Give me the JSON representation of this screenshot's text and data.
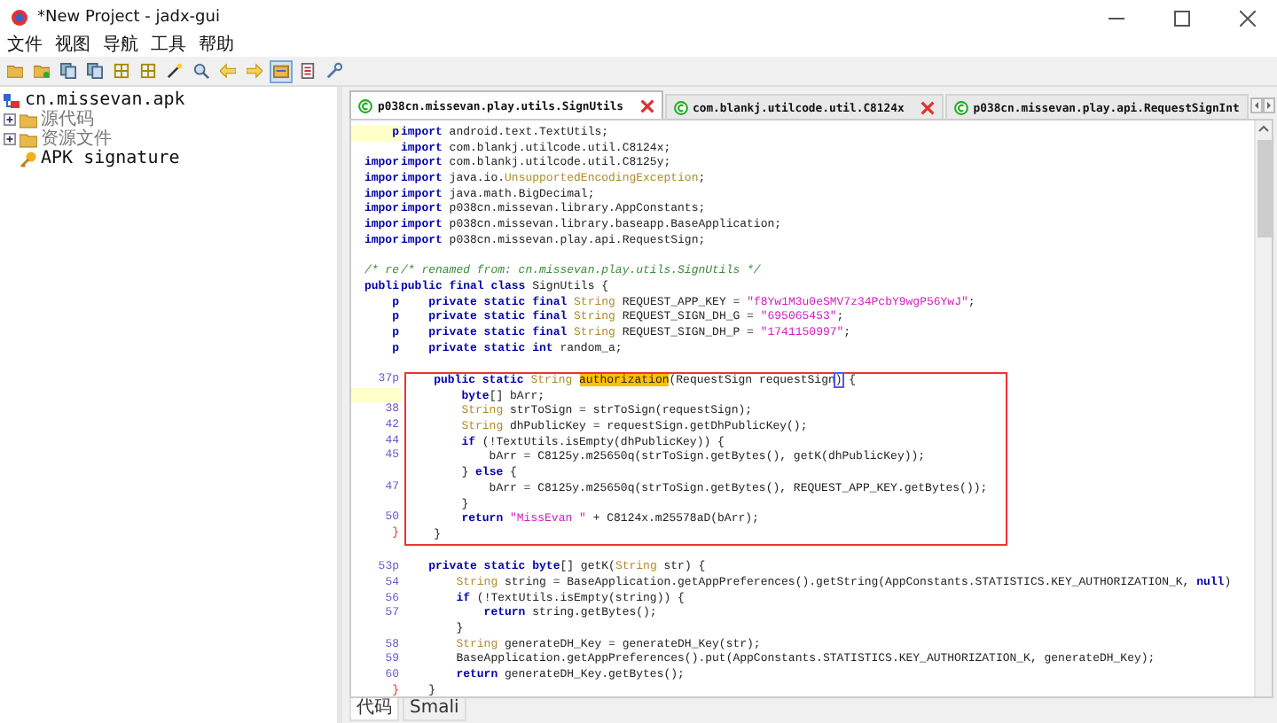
{
  "window": {
    "title": "*New Project - jadx-gui"
  },
  "menu": [
    "文件",
    "视图",
    "导航",
    "工具",
    "帮助"
  ],
  "toolbar": {
    "buttons": [
      {
        "kind": "open",
        "selected": false
      },
      {
        "kind": "add",
        "selected": false
      },
      {
        "kind": "copy",
        "selected": false
      },
      {
        "kind": "copy",
        "selected": false
      },
      {
        "kind": "tree",
        "selected": false
      },
      {
        "kind": "grid",
        "selected": false
      },
      {
        "kind": "wand",
        "selected": false
      },
      {
        "kind": "search",
        "selected": false
      },
      {
        "kind": "back",
        "selected": false
      },
      {
        "kind": "forward",
        "selected": false
      },
      {
        "kind": "sync",
        "selected": true
      },
      {
        "kind": "log",
        "selected": false
      },
      {
        "kind": "wrench",
        "selected": false
      }
    ]
  },
  "tree": {
    "root": {
      "label": "cn.missevan.apk",
      "children": [
        {
          "label": "源代码",
          "kind": "folder",
          "expanded": false
        },
        {
          "label": "资源文件",
          "kind": "folder",
          "expanded": false
        },
        {
          "label": "APK signature",
          "kind": "key"
        }
      ]
    }
  },
  "editor_tabs": [
    {
      "label": "p038cn.missevan.play.utils.SignUtils",
      "selected": true,
      "closable": true
    },
    {
      "label": "com.blankj.utilcode.util.C8124x",
      "selected": false,
      "closable": true
    },
    {
      "label": "p038cn.missevan.play.api.RequestSignInt",
      "selected": false,
      "closable": false
    }
  ],
  "code": {
    "blocks": [
      {
        "kind": "plain",
        "lines": [
          {
            "gutter": {
              "kind": "mark",
              "text": "p"
            },
            "highlighted": true,
            "tokens": [
              {
                "kind": "kw",
                "text": "import"
              },
              {
                "kind": "plain",
                "text": " android.text.TextUtils;"
              }
            ]
          },
          {
            "highlighted": false,
            "tokens": [
              {
                "kind": "kw",
                "text": "import"
              },
              {
                "kind": "plain",
                "text": " com.blankj.utilcode.util.C8124x;"
              }
            ]
          },
          {
            "gutter": {
              "kind": "mark",
              "text": "impor"
            },
            "highlighted": false,
            "tokens": [
              {
                "kind": "kw",
                "text": "import"
              },
              {
                "kind": "plain",
                "text": " com.blankj.utilcode.util.C8125y;"
              }
            ]
          },
          {
            "gutter": {
              "kind": "mark",
              "text": "impor"
            },
            "highlighted": false,
            "tokens": [
              {
                "kind": "kw",
                "text": "import"
              },
              {
                "kind": "plain",
                "text": " java.io."
              },
              {
                "kind": "type",
                "text": "UnsupportedEncodingException"
              },
              {
                "kind": "plain",
                "text": ";"
              }
            ]
          },
          {
            "gutter": {
              "kind": "mark",
              "text": "impor"
            },
            "highlighted": false,
            "tokens": [
              {
                "kind": "kw",
                "text": "import"
              },
              {
                "kind": "plain",
                "text": " java.math.BigDecimal;"
              }
            ]
          },
          {
            "gutter": {
              "kind": "mark",
              "text": "impor"
            },
            "highlighted": false,
            "tokens": [
              {
                "kind": "kw",
                "text": "import"
              },
              {
                "kind": "plain",
                "text": " p038cn.missevan.library.AppConstants;"
              }
            ]
          },
          {
            "gutter": {
              "kind": "mark",
              "text": "impor"
            },
            "highlighted": false,
            "tokens": [
              {
                "kind": "kw",
                "text": "import"
              },
              {
                "kind": "plain",
                "text": " p038cn.missevan.library.baseapp.BaseApplication;"
              }
            ]
          },
          {
            "gutter": {
              "kind": "mark",
              "text": "impor"
            },
            "highlighted": false,
            "tokens": [
              {
                "kind": "kw",
                "text": "import"
              },
              {
                "kind": "plain",
                "text": " p038cn.missevan.play.api.RequestSign;"
              }
            ]
          },
          {
            "highlighted": false
          },
          {
            "gutter": {
              "kind": "com",
              "text": "/* re"
            },
            "highlighted": false,
            "tokens": [
              {
                "kind": "com",
                "text": "/* renamed from: cn.missevan.play.utils.SignUtils */"
              }
            ]
          },
          {
            "gutter": {
              "kind": "mark",
              "text": "publi"
            },
            "highlighted": false,
            "tokens": [
              {
                "kind": "kw",
                "text": "public final class"
              },
              {
                "kind": "plain",
                "text": " SignUtils {"
              }
            ]
          },
          {
            "gutter": {
              "kind": "mark",
              "text": "p"
            },
            "highlighted": false,
            "tokens": [
              {
                "kind": "kw",
                "text": "    private static final"
              },
              {
                "kind": "type",
                "text": " String"
              },
              {
                "kind": "plain",
                "text": " REQUEST_APP_KEY = "
              },
              {
                "kind": "str",
                "text": "\"f8Yw1M3u0eSMV7z34PcbY9wgP56YwJ\""
              },
              {
                "kind": "plain",
                "text": ";"
              }
            ]
          },
          {
            "gutter": {
              "kind": "mark",
              "text": "p"
            },
            "highlighted": false,
            "tokens": [
              {
                "kind": "kw",
                "text": "    private static final"
              },
              {
                "kind": "type",
                "text": " String"
              },
              {
                "kind": "plain",
                "text": " REQUEST_SIGN_DH_G = "
              },
              {
                "kind": "str",
                "text": "\"695065453\""
              },
              {
                "kind": "plain",
                "text": ";"
              }
            ]
          },
          {
            "gutter": {
              "kind": "mark",
              "text": "p"
            },
            "highlighted": false,
            "tokens": [
              {
                "kind": "kw",
                "text": "    private static final"
              },
              {
                "kind": "type",
                "text": " String"
              },
              {
                "kind": "plain",
                "text": " REQUEST_SIGN_DH_P = "
              },
              {
                "kind": "str",
                "text": "\"1741150997\""
              },
              {
                "kind": "plain",
                "text": ";"
              }
            ]
          },
          {
            "gutter": {
              "kind": "mark",
              "text": "p"
            },
            "highlighted": false,
            "tokens": [
              {
                "kind": "kw",
                "text": "    private static int"
              },
              {
                "kind": "plain",
                "text": " random_a;"
              }
            ]
          },
          {
            "highlighted": false
          }
        ]
      },
      {
        "kind": "boxed",
        "lines": [
          {
            "gutter": {
              "kind": "num",
              "text": "37p"
            },
            "highlighted": false,
            "tokens": [
              {
                "kind": "kw",
                "text": "    public static"
              },
              {
                "kind": "type",
                "text": " String "
              },
              {
                "kind": "hl",
                "text": "authorization"
              },
              {
                "kind": "plain",
                "text": "(RequestSign requestSign"
              },
              {
                "kind": "match",
                "text": ")"
              },
              {
                "kind": "plain",
                "text": " {"
              }
            ]
          },
          {
            "highlighted": true,
            "tokens": [
              {
                "kind": "kw",
                "text": "        byte"
              },
              {
                "kind": "plain",
                "text": "[] bArr;"
              }
            ]
          },
          {
            "gutter": {
              "kind": "num",
              "text": "38"
            },
            "highlighted": false,
            "tokens": [
              {
                "kind": "type",
                "text": "        String"
              },
              {
                "kind": "plain",
                "text": " strToSign = strToSign(requestSign);"
              }
            ]
          },
          {
            "gutter": {
              "kind": "num",
              "text": "42"
            },
            "highlighted": false,
            "tokens": [
              {
                "kind": "type",
                "text": "        String"
              },
              {
                "kind": "plain",
                "text": " dhPublicKey = requestSign.getDhPublicKey();"
              }
            ]
          },
          {
            "gutter": {
              "kind": "num",
              "text": "44"
            },
            "highlighted": false,
            "tokens": [
              {
                "kind": "kw",
                "text": "        if"
              },
              {
                "kind": "plain",
                "text": " (!TextUtils.isEmpty(dhPublicKey)) {"
              }
            ]
          },
          {
            "gutter": {
              "kind": "num",
              "text": "45"
            },
            "highlighted": false,
            "tokens": [
              {
                "kind": "plain",
                "text": "            bArr = C8125y.m25650q(strToSign.getBytes(), getK(dhPublicKey));"
              }
            ]
          },
          {
            "highlighted": false,
            "tokens": [
              {
                "kind": "plain",
                "text": "        } "
              },
              {
                "kind": "kw",
                "text": "else"
              },
              {
                "kind": "plain",
                "text": " {"
              }
            ]
          },
          {
            "gutter": {
              "kind": "num",
              "text": "47"
            },
            "highlighted": false,
            "tokens": [
              {
                "kind": "plain",
                "text": "            bArr = C8125y.m25650q(strToSign.getBytes(), REQUEST_APP_KEY.getBytes());"
              }
            ]
          },
          {
            "highlighted": false,
            "tokens": [
              {
                "kind": "plain",
                "text": "        }"
              }
            ]
          },
          {
            "gutter": {
              "kind": "num",
              "text": "50"
            },
            "highlighted": false,
            "tokens": [
              {
                "kind": "kw",
                "text": "        return"
              },
              {
                "kind": "str",
                "text": " \"MissEvan \""
              },
              {
                "kind": "plain",
                "text": " + C8124x.m25578aD(bArr);"
              }
            ]
          },
          {
            "gutter": {
              "kind": "brace",
              "text": "}"
            },
            "highlighted": false,
            "tokens": [
              {
                "kind": "plain",
                "text": "    }"
              }
            ]
          }
        ]
      },
      {
        "kind": "plain",
        "lines": [
          {
            "highlighted": false
          },
          {
            "gutter": {
              "kind": "num",
              "text": "53p"
            },
            "highlighted": false,
            "tokens": [
              {
                "kind": "kw",
                "text": "    private static byte"
              },
              {
                "kind": "plain",
                "text": "[] getK("
              },
              {
                "kind": "type",
                "text": "String"
              },
              {
                "kind": "plain",
                "text": " str) {"
              }
            ]
          },
          {
            "gutter": {
              "kind": "num",
              "text": "54"
            },
            "highlighted": false,
            "tokens": [
              {
                "kind": "type",
                "text": "        String"
              },
              {
                "kind": "plain",
                "text": " string = BaseApplication.getAppPreferences().getString(AppConstants.STATISTICS.KEY_AUTHORIZATION_K, "
              },
              {
                "kind": "kw",
                "text": "null"
              },
              {
                "kind": "plain",
                "text": ")"
              }
            ]
          },
          {
            "gutter": {
              "kind": "num",
              "text": "56"
            },
            "highlighted": false,
            "tokens": [
              {
                "kind": "kw",
                "text": "        if"
              },
              {
                "kind": "plain",
                "text": " (!TextUtils.isEmpty(string)) {"
              }
            ]
          },
          {
            "gutter": {
              "kind": "num",
              "text": "57"
            },
            "highlighted": false,
            "tokens": [
              {
                "kind": "kw",
                "text": "            return"
              },
              {
                "kind": "plain",
                "text": " string.getBytes();"
              }
            ]
          },
          {
            "highlighted": false,
            "tokens": [
              {
                "kind": "plain",
                "text": "        }"
              }
            ]
          },
          {
            "gutter": {
              "kind": "num",
              "text": "58"
            },
            "highlighted": false,
            "tokens": [
              {
                "kind": "type",
                "text": "        String"
              },
              {
                "kind": "plain",
                "text": " generateDH_Key = generateDH_Key(str);"
              }
            ]
          },
          {
            "gutter": {
              "kind": "num",
              "text": "59"
            },
            "highlighted": false,
            "tokens": [
              {
                "kind": "plain",
                "text": "        BaseApplication.getAppPreferences().put(AppConstants.STATISTICS.KEY_AUTHORIZATION_K, generateDH_Key);"
              }
            ]
          },
          {
            "gutter": {
              "kind": "num",
              "text": "60"
            },
            "highlighted": false,
            "tokens": [
              {
                "kind": "kw",
                "text": "        return"
              },
              {
                "kind": "plain",
                "text": " generateDH_Key.getBytes();"
              }
            ]
          },
          {
            "gutter": {
              "kind": "brace",
              "text": "}"
            },
            "highlighted": false,
            "tokens": [
              {
                "kind": "plain",
                "text": "    }"
              }
            ]
          }
        ]
      }
    ]
  },
  "bottom_tabs": [
    {
      "label": "代码",
      "selected": true
    },
    {
      "label": "Smali",
      "selected": false
    }
  ]
}
